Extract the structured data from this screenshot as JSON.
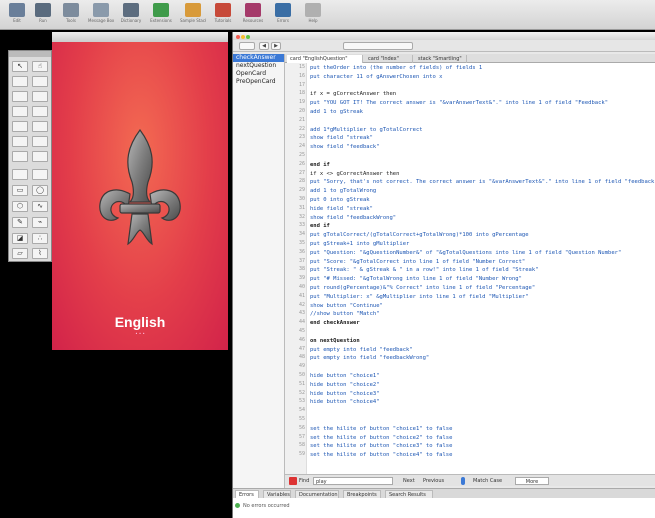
{
  "toolbar": {
    "buttons": [
      {
        "label": "Edit",
        "icon": "edit-icon",
        "color": "#6a7f9a"
      },
      {
        "label": "Run",
        "icon": "run-icon",
        "color": "#5a6b7e"
      },
      {
        "label": "Tools",
        "icon": "tools-icon",
        "color": "#7d8c9d"
      },
      {
        "label": "Message Box",
        "icon": "message-box-icon",
        "color": "#8a9aab"
      },
      {
        "label": "Dictionary",
        "icon": "dictionary-icon",
        "color": "#5d6d7f"
      },
      {
        "label": "Extensions",
        "icon": "extensions-icon",
        "color": "#3f9b4a"
      },
      {
        "label": "Sample Stacks",
        "icon": "sample-stacks-icon",
        "color": "#d89a3a"
      },
      {
        "label": "Tutorials",
        "icon": "tutorials-icon",
        "color": "#c74a3a"
      },
      {
        "label": "Resources",
        "icon": "resources-icon",
        "color": "#a53a6a"
      },
      {
        "label": "Errors",
        "icon": "errors-icon",
        "color": "#3a6ea5"
      },
      {
        "label": "Help",
        "icon": "help-icon",
        "color": "#b0b0b0"
      }
    ]
  },
  "stack": {
    "language_label": "English"
  },
  "editor": {
    "browser_items": [
      {
        "label": "checkAnswer",
        "selected": true
      },
      {
        "label": "nextQuestion",
        "selected": false
      },
      {
        "label": "OpenCard",
        "selected": false
      },
      {
        "label": "PreOpenCard",
        "selected": false
      }
    ],
    "tabs": [
      {
        "label": "card \"EnglishQuestion\"",
        "active": true
      },
      {
        "label": "card \"Index\"",
        "active": false
      },
      {
        "label": "stack \"Smartling\"",
        "active": false
      }
    ],
    "first_line_number": 15,
    "code_lines": [
      "  put theOrder into (the number of fields) of fields 1",
      "  put character 11 of gAnswerChosen into x",
      "",
      "  if x = gCorrectAnswer then",
      "     put \"YOU GOT IT! The correct answer is \"&varAnswerText&\".\" into line 1 of field \"Feedback\"",
      "     add 1 to gStreak",
      "",
      "     add 1*gMultiplier to gTotalCorrect",
      "     show field \"streak\"",
      "     show field \"feedback\"",
      "",
      "  end if",
      "  if x <> gCorrectAnswer then",
      "     put \"Sorry, that's not correct. The correct answer is \"&varAnswerText&\".\" into line 1 of field \"feedback\"",
      "     add 1 to gTotalWrong",
      "     put 0 into gStreak",
      "     hide field \"streak\"",
      "     show field \"feedbackWrong\"",
      "  end if",
      "  put gTotalCorrect/(gTotalCorrect+gTotalWrong)*100 into gPercentage",
      "  put gStreak+1 into gMultiplier",
      "  put \"Question: \"&gQuestionNumber&\" of \"&gTotalQuestions into line 1 of field \"Question Number\"",
      "  put \"Score: \"&gTotalCorrect into line 1 of field \"Number Correct\"",
      "  put \"Streak: \" & gStreak & \" in a row!\" into line 1 of field \"Streak\"",
      "  put \"# Missed: \"&gTotalWrong into line 1 of field \"Number Wrong\"",
      "  put round(gPercentage)&\"% Correct\" into line 1 of field \"Percentage\"",
      "  put \"Multiplier: x\" &gMultiplier into line 1 of field \"Multiplier\"",
      "  show button \"Continue\"",
      "  //show button \"Match\"",
      "end checkAnswer",
      "",
      "on nextQuestion",
      "  put empty into field \"feedback\"",
      "  put empty into field \"feedbackWrong\"",
      "",
      "  hide button \"choice1\"",
      "  hide button \"choice2\"",
      "  hide button \"choice3\"",
      "  hide button \"choice4\"",
      "",
      "",
      "  set the hilite of button \"choice1\" to false",
      "  set the hilite of button \"choice2\" to false",
      "  set the hilite of button \"choice3\" to false",
      "  set the hilite of button \"choice4\" to false"
    ],
    "find_bar": {
      "find_label": "Find",
      "find_value": "play",
      "next_label": "Next",
      "previous_label": "Previous",
      "match_case_label": "Match Case",
      "more_label": "More"
    },
    "bottom_tabs": [
      "Errors",
      "Variables",
      "Documentation",
      "Breakpoints",
      "Search Results"
    ],
    "status_message": "No errors occurred"
  },
  "colors": {
    "keyword": "#1b55b3",
    "string": "#b13aa8",
    "handler": "#1a1a1a",
    "selection": "#3b79d6",
    "card_top": "#f36a52",
    "card_bottom": "#d2234a"
  }
}
